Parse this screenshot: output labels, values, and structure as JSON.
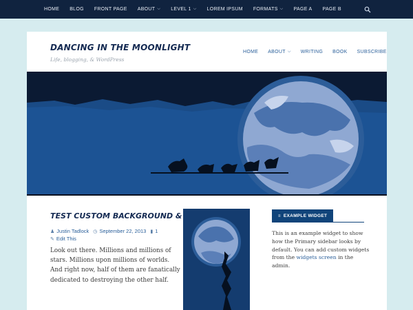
{
  "topnav": {
    "items": [
      {
        "label": "HOME",
        "dropdown": false
      },
      {
        "label": "BLOG",
        "dropdown": false
      },
      {
        "label": "FRONT PAGE",
        "dropdown": false
      },
      {
        "label": "ABOUT",
        "dropdown": true
      },
      {
        "label": "LEVEL 1",
        "dropdown": true
      },
      {
        "label": "LOREM IPSUM",
        "dropdown": false
      },
      {
        "label": "FORMATS",
        "dropdown": true
      },
      {
        "label": "PAGE A",
        "dropdown": false
      },
      {
        "label": "PAGE B",
        "dropdown": false
      }
    ],
    "search_icon": "search-icon"
  },
  "site": {
    "title": "DANCING IN THE MOONLIGHT",
    "description": "Life, blogging, & WordPress"
  },
  "mainnav": {
    "items": [
      {
        "label": "HOME",
        "dropdown": false
      },
      {
        "label": "ABOUT",
        "dropdown": true
      },
      {
        "label": "WRITING",
        "dropdown": false
      },
      {
        "label": "BOOK",
        "dropdown": false
      },
      {
        "label": "SUBSCRIBE",
        "dropdown": false
      }
    ]
  },
  "post": {
    "title": "TEST CUSTOM BACKGROUND & HEADER",
    "author": "Justin Tadlock",
    "date": "September 22, 2013",
    "comments": "1",
    "edit": "Edit This",
    "body": "Look out there. Millions and millions of stars. Millions upon millions of worlds. And right now, half of them are fanatically dedicated to destroying the other half."
  },
  "widget": {
    "title": "EXAMPLE WIDGET",
    "text_before": "This is an example widget to show how the Primary sidebar looks by default. You can add custom widgets from the ",
    "link": "widgets screen",
    "text_after": " in the admin."
  },
  "colors": {
    "background": "#d6ecef",
    "topbar": "#10233f",
    "title": "#142a52",
    "link": "#2a5f9a",
    "widget_accent": "#10447a"
  }
}
